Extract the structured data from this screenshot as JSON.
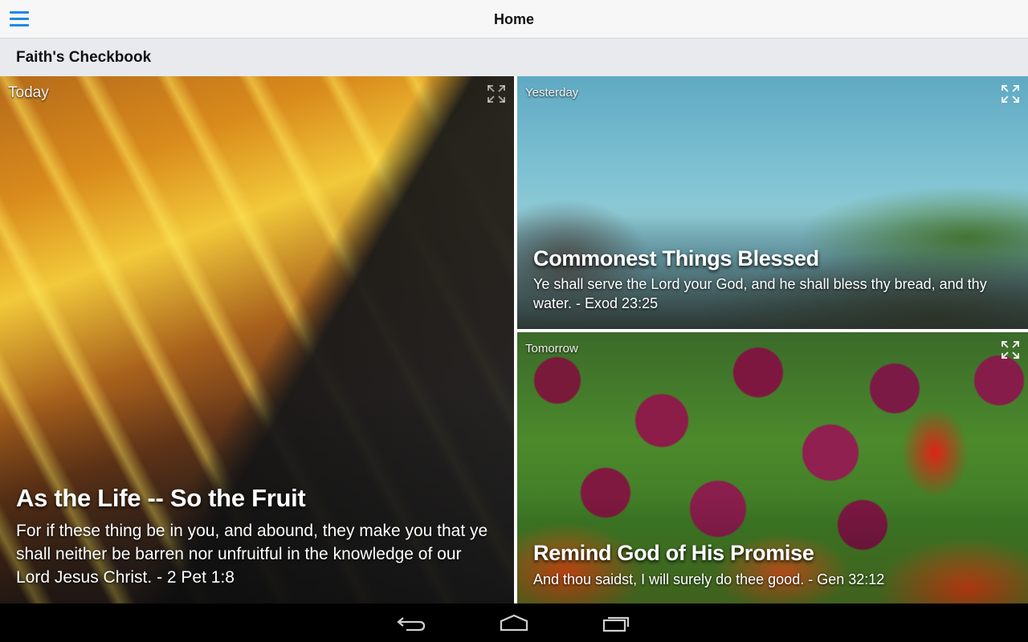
{
  "header": {
    "title": "Home",
    "menu_icon": "hamburger-menu-icon",
    "accent_color": "#1e88e5"
  },
  "subheader": {
    "title": "Faith's Checkbook"
  },
  "tiles": {
    "today": {
      "day_label": "Today",
      "heading": "As the Life -- So the Fruit",
      "verse": "For if these thing be in you, and abound, they make you that ye shall neither be barren nor unfruitful in the knowledge of our Lord Jesus Christ. - 2 Pet 1:8",
      "expand_icon": "expand-icon"
    },
    "yesterday": {
      "day_label": "Yesterday",
      "heading": "Commonest Things Blessed",
      "verse": "Ye shall serve the Lord your God, and he shall bless thy bread, and thy water. - Exod 23:25",
      "expand_icon": "expand-icon"
    },
    "tomorrow": {
      "day_label": "Tomorrow",
      "heading": "Remind God of His Promise",
      "verse": "And thou saidst, I will surely do thee good. - Gen 32:12",
      "expand_icon": "expand-icon"
    }
  },
  "navbar": {
    "icons": [
      "back-icon",
      "home-icon",
      "recents-icon"
    ]
  }
}
